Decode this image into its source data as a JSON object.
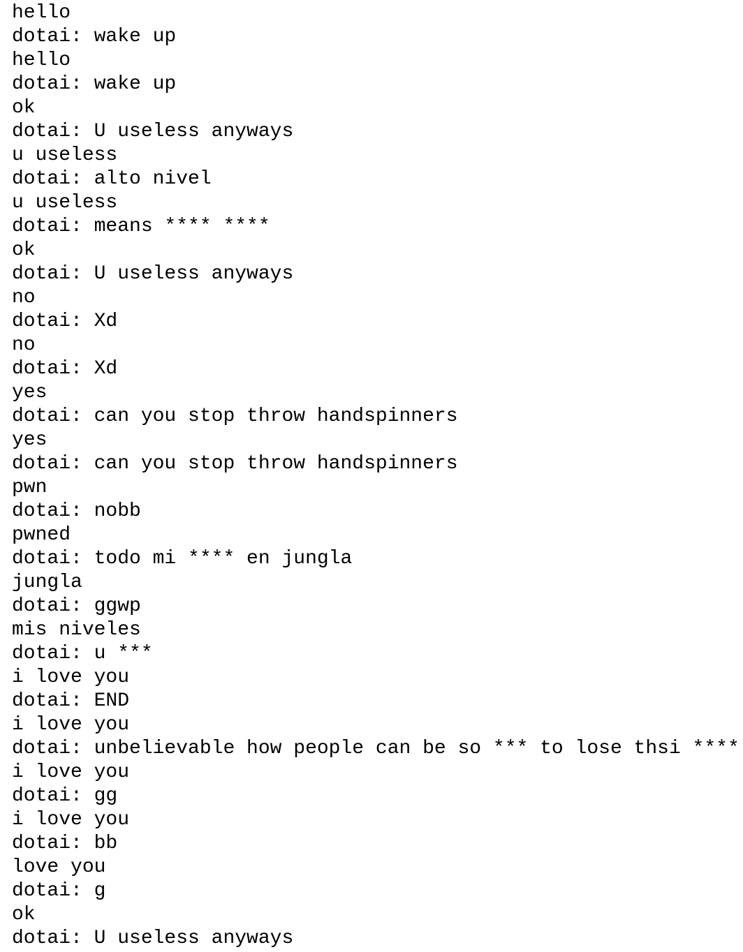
{
  "transcript": {
    "lines": [
      "hello",
      "dotai: wake up",
      "hello",
      "dotai: wake up",
      "ok",
      "dotai: U useless anyways",
      "u useless",
      "dotai: alto nivel",
      "u useless",
      "dotai: means **** ****",
      "ok",
      "dotai: U useless anyways",
      "no",
      "dotai: Xd",
      "no",
      "dotai: Xd",
      "yes",
      "dotai: can you stop throw handspinners",
      "yes",
      "dotai: can you stop throw handspinners",
      "pwn",
      "dotai: nobb",
      "pwned",
      "dotai: todo mi **** en jungla",
      "jungla",
      "dotai: ggwp",
      "mis niveles",
      "dotai: u ***",
      "i love you",
      "dotai: END",
      "i love you",
      "dotai: unbelievable how people can be so *** to lose thsi ****",
      "i love you",
      "dotai: gg",
      "i love you",
      "dotai: bb",
      "love you",
      "dotai: g",
      "ok",
      "dotai: U useless anyways"
    ]
  }
}
